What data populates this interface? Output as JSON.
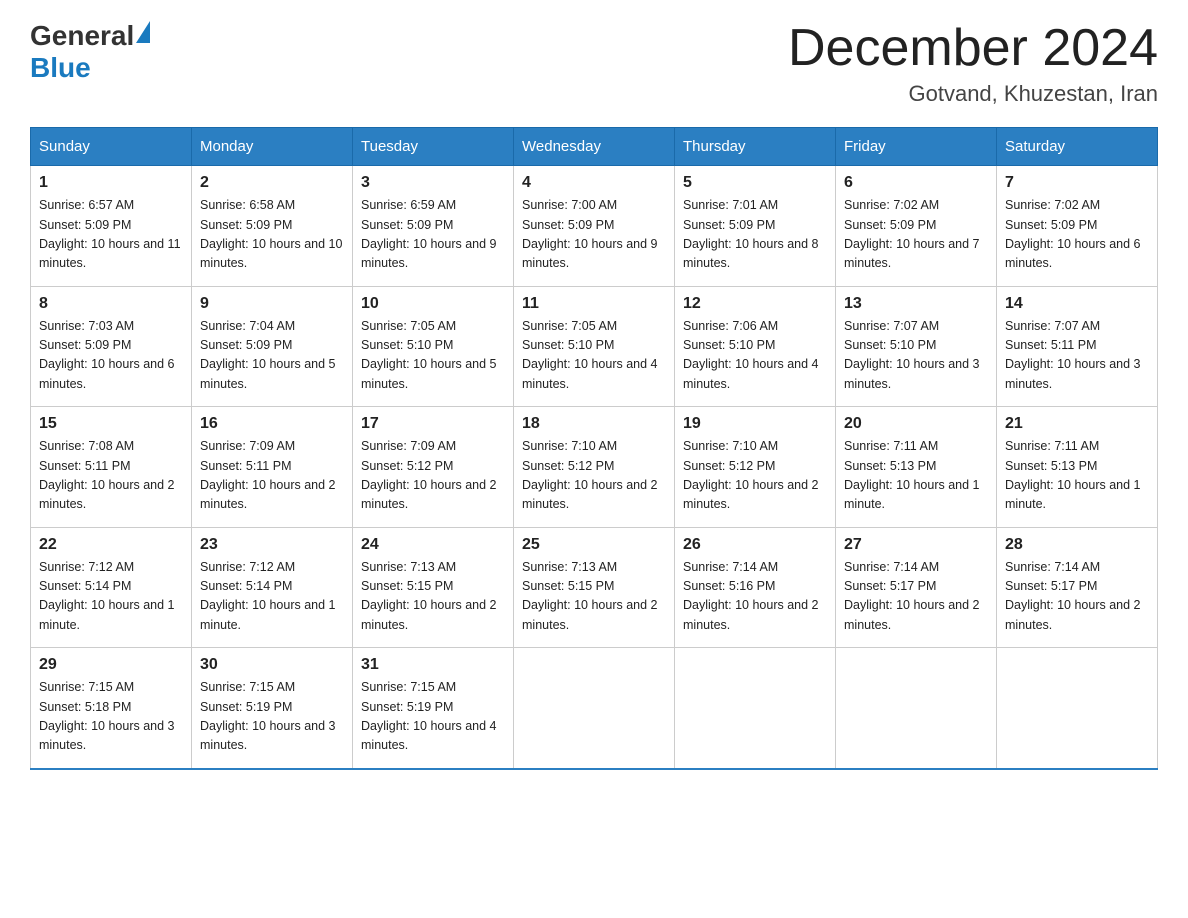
{
  "logo": {
    "text_general": "General",
    "text_blue": "Blue"
  },
  "header": {
    "month_title": "December 2024",
    "location": "Gotvand, Khuzestan, Iran"
  },
  "days_of_week": [
    "Sunday",
    "Monday",
    "Tuesday",
    "Wednesday",
    "Thursday",
    "Friday",
    "Saturday"
  ],
  "weeks": [
    [
      {
        "day": "1",
        "sunrise": "Sunrise: 6:57 AM",
        "sunset": "Sunset: 5:09 PM",
        "daylight": "Daylight: 10 hours and 11 minutes."
      },
      {
        "day": "2",
        "sunrise": "Sunrise: 6:58 AM",
        "sunset": "Sunset: 5:09 PM",
        "daylight": "Daylight: 10 hours and 10 minutes."
      },
      {
        "day": "3",
        "sunrise": "Sunrise: 6:59 AM",
        "sunset": "Sunset: 5:09 PM",
        "daylight": "Daylight: 10 hours and 9 minutes."
      },
      {
        "day": "4",
        "sunrise": "Sunrise: 7:00 AM",
        "sunset": "Sunset: 5:09 PM",
        "daylight": "Daylight: 10 hours and 9 minutes."
      },
      {
        "day": "5",
        "sunrise": "Sunrise: 7:01 AM",
        "sunset": "Sunset: 5:09 PM",
        "daylight": "Daylight: 10 hours and 8 minutes."
      },
      {
        "day": "6",
        "sunrise": "Sunrise: 7:02 AM",
        "sunset": "Sunset: 5:09 PM",
        "daylight": "Daylight: 10 hours and 7 minutes."
      },
      {
        "day": "7",
        "sunrise": "Sunrise: 7:02 AM",
        "sunset": "Sunset: 5:09 PM",
        "daylight": "Daylight: 10 hours and 6 minutes."
      }
    ],
    [
      {
        "day": "8",
        "sunrise": "Sunrise: 7:03 AM",
        "sunset": "Sunset: 5:09 PM",
        "daylight": "Daylight: 10 hours and 6 minutes."
      },
      {
        "day": "9",
        "sunrise": "Sunrise: 7:04 AM",
        "sunset": "Sunset: 5:09 PM",
        "daylight": "Daylight: 10 hours and 5 minutes."
      },
      {
        "day": "10",
        "sunrise": "Sunrise: 7:05 AM",
        "sunset": "Sunset: 5:10 PM",
        "daylight": "Daylight: 10 hours and 5 minutes."
      },
      {
        "day": "11",
        "sunrise": "Sunrise: 7:05 AM",
        "sunset": "Sunset: 5:10 PM",
        "daylight": "Daylight: 10 hours and 4 minutes."
      },
      {
        "day": "12",
        "sunrise": "Sunrise: 7:06 AM",
        "sunset": "Sunset: 5:10 PM",
        "daylight": "Daylight: 10 hours and 4 minutes."
      },
      {
        "day": "13",
        "sunrise": "Sunrise: 7:07 AM",
        "sunset": "Sunset: 5:10 PM",
        "daylight": "Daylight: 10 hours and 3 minutes."
      },
      {
        "day": "14",
        "sunrise": "Sunrise: 7:07 AM",
        "sunset": "Sunset: 5:11 PM",
        "daylight": "Daylight: 10 hours and 3 minutes."
      }
    ],
    [
      {
        "day": "15",
        "sunrise": "Sunrise: 7:08 AM",
        "sunset": "Sunset: 5:11 PM",
        "daylight": "Daylight: 10 hours and 2 minutes."
      },
      {
        "day": "16",
        "sunrise": "Sunrise: 7:09 AM",
        "sunset": "Sunset: 5:11 PM",
        "daylight": "Daylight: 10 hours and 2 minutes."
      },
      {
        "day": "17",
        "sunrise": "Sunrise: 7:09 AM",
        "sunset": "Sunset: 5:12 PM",
        "daylight": "Daylight: 10 hours and 2 minutes."
      },
      {
        "day": "18",
        "sunrise": "Sunrise: 7:10 AM",
        "sunset": "Sunset: 5:12 PM",
        "daylight": "Daylight: 10 hours and 2 minutes."
      },
      {
        "day": "19",
        "sunrise": "Sunrise: 7:10 AM",
        "sunset": "Sunset: 5:12 PM",
        "daylight": "Daylight: 10 hours and 2 minutes."
      },
      {
        "day": "20",
        "sunrise": "Sunrise: 7:11 AM",
        "sunset": "Sunset: 5:13 PM",
        "daylight": "Daylight: 10 hours and 1 minute."
      },
      {
        "day": "21",
        "sunrise": "Sunrise: 7:11 AM",
        "sunset": "Sunset: 5:13 PM",
        "daylight": "Daylight: 10 hours and 1 minute."
      }
    ],
    [
      {
        "day": "22",
        "sunrise": "Sunrise: 7:12 AM",
        "sunset": "Sunset: 5:14 PM",
        "daylight": "Daylight: 10 hours and 1 minute."
      },
      {
        "day": "23",
        "sunrise": "Sunrise: 7:12 AM",
        "sunset": "Sunset: 5:14 PM",
        "daylight": "Daylight: 10 hours and 1 minute."
      },
      {
        "day": "24",
        "sunrise": "Sunrise: 7:13 AM",
        "sunset": "Sunset: 5:15 PM",
        "daylight": "Daylight: 10 hours and 2 minutes."
      },
      {
        "day": "25",
        "sunrise": "Sunrise: 7:13 AM",
        "sunset": "Sunset: 5:15 PM",
        "daylight": "Daylight: 10 hours and 2 minutes."
      },
      {
        "day": "26",
        "sunrise": "Sunrise: 7:14 AM",
        "sunset": "Sunset: 5:16 PM",
        "daylight": "Daylight: 10 hours and 2 minutes."
      },
      {
        "day": "27",
        "sunrise": "Sunrise: 7:14 AM",
        "sunset": "Sunset: 5:17 PM",
        "daylight": "Daylight: 10 hours and 2 minutes."
      },
      {
        "day": "28",
        "sunrise": "Sunrise: 7:14 AM",
        "sunset": "Sunset: 5:17 PM",
        "daylight": "Daylight: 10 hours and 2 minutes."
      }
    ],
    [
      {
        "day": "29",
        "sunrise": "Sunrise: 7:15 AM",
        "sunset": "Sunset: 5:18 PM",
        "daylight": "Daylight: 10 hours and 3 minutes."
      },
      {
        "day": "30",
        "sunrise": "Sunrise: 7:15 AM",
        "sunset": "Sunset: 5:19 PM",
        "daylight": "Daylight: 10 hours and 3 minutes."
      },
      {
        "day": "31",
        "sunrise": "Sunrise: 7:15 AM",
        "sunset": "Sunset: 5:19 PM",
        "daylight": "Daylight: 10 hours and 4 minutes."
      },
      null,
      null,
      null,
      null
    ]
  ]
}
